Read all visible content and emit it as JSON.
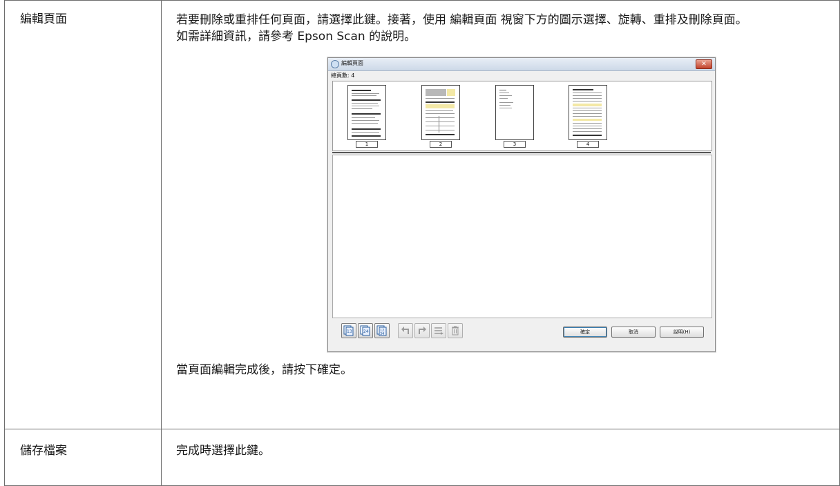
{
  "rows": [
    {
      "label": "編輯頁面",
      "line1": "若要刪除或重排任何頁面，請選擇此鍵。接著，使用 編輯頁面 視窗下方的圖示選擇、旋轉、重排及刪除頁面。",
      "line2": "如需詳細資訊，請參考 Epson Scan 的說明。",
      "footer": "當頁面編輯完成後，請按下確定。"
    },
    {
      "label": "儲存檔案",
      "line1": "完成時選擇此鍵。"
    }
  ],
  "dialog": {
    "title": "編輯頁面",
    "close_glyph": "✕",
    "page_count": "總頁數: 4",
    "pages": [
      "1",
      "2",
      "3",
      "4"
    ],
    "toolbar_icons": [
      "select-odd-pages-icon",
      "select-even-pages-icon",
      "select-all-pages-icon",
      "rotate-left-icon",
      "rotate-right-icon",
      "reorder-icon",
      "delete-icon"
    ],
    "buttons": {
      "ok": "確定",
      "cancel": "取消",
      "help": "說明(H)"
    }
  }
}
